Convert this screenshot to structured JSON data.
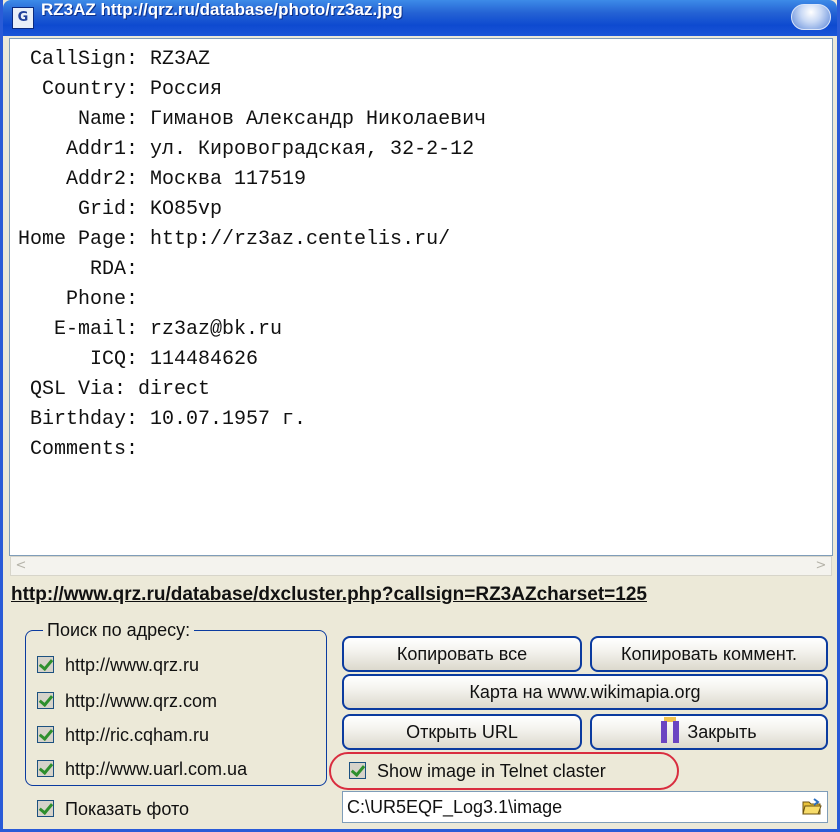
{
  "window": {
    "title": "RZ3AZ http://qrz.ru/database/photo/rz3az.jpg",
    "app_icon": "callbook-app-icon",
    "title_button": "minimize-orb"
  },
  "info": {
    "lines": [
      " CallSign: RZ3AZ",
      "  Country: Россия",
      "     Name: Гиманов Александр Николаевич",
      "    Addr1: ул. Кировоградская, 32-2-12",
      "    Addr2: Москва 117519",
      "     Grid: KO85vp",
      "Home Page: http://rz3az.centelis.ru/",
      "      RDA:",
      "    Phone:",
      "   E-mail: rz3az@bk.ru",
      "      ICQ: 114484626",
      " QSL Via: direct",
      " Birthday: 10.07.1957 г.",
      " Comments:"
    ]
  },
  "scroll": {
    "left": "<",
    "right": ">"
  },
  "url": "http://www.qrz.ru/database/dxcluster.php?callsign=RZ3AZcharset=125",
  "search": {
    "title": "Поиск по адресу:",
    "sites": [
      "http://www.qrz.ru",
      "http://www.qrz.com",
      "http://ric.cqham.ru",
      "http://www.uarl.com.ua"
    ]
  },
  "buttons": {
    "copy_all": "Копировать все",
    "copy_comment": "Копировать коммент.",
    "map": "Карта на www.wikimapia.org",
    "open_url": "Открыть URL",
    "close": "Закрыть"
  },
  "options": {
    "show_telnet": "Show image in Telnet claster",
    "show_photo": "Показать фото"
  },
  "path": {
    "value": "C:\\UR5EQF_Log3.1\\image"
  },
  "colors": {
    "titlebar": "#0e4ad0",
    "highlight": "#d92d3f",
    "check": "#2d8f2d"
  }
}
